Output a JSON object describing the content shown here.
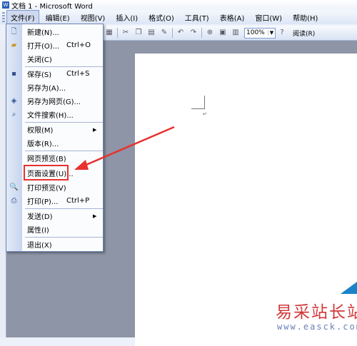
{
  "window": {
    "app_icon_letter": "W",
    "title": "文档 1 - Microsoft Word"
  },
  "menubar": [
    {
      "label": "文件(F)",
      "active": true
    },
    {
      "label": "编辑(E)"
    },
    {
      "label": "视图(V)"
    },
    {
      "label": "插入(I)"
    },
    {
      "label": "格式(O)"
    },
    {
      "label": "工具(T)"
    },
    {
      "label": "表格(A)"
    },
    {
      "label": "窗口(W)"
    },
    {
      "label": "帮助(H)"
    }
  ],
  "toolbar": {
    "zoom_value": "100%",
    "read_label": "阅读(R)"
  },
  "file_menu": {
    "items": [
      {
        "label": "新建(N)...",
        "shortcut": "",
        "icon": "new-doc-icon"
      },
      {
        "label": "打开(O)...",
        "shortcut": "Ctrl+O",
        "icon": "open-folder-icon"
      },
      {
        "label": "关闭(C)",
        "shortcut": "",
        "icon": ""
      },
      {
        "label": "保存(S)",
        "shortcut": "Ctrl+S",
        "icon": "save-disk-icon"
      },
      {
        "label": "另存为(A)...",
        "shortcut": "",
        "icon": ""
      },
      {
        "label": "另存为网页(G)...",
        "shortcut": "",
        "icon": "save-web-icon"
      },
      {
        "label": "文件搜索(H)...",
        "shortcut": "",
        "icon": "file-search-icon"
      },
      {
        "label": "权限(M)",
        "shortcut": "",
        "icon": "",
        "submenu": true
      },
      {
        "label": "版本(R)...",
        "shortcut": "",
        "icon": ""
      },
      {
        "label": "网页预览(B)",
        "shortcut": "",
        "icon": ""
      },
      {
        "label": "页面设置(U)...",
        "shortcut": "",
        "icon": "",
        "highlighted": true
      },
      {
        "label": "打印预览(V)",
        "shortcut": "",
        "icon": "print-preview-icon"
      },
      {
        "label": "打印(P)...",
        "shortcut": "Ctrl+P",
        "icon": "printer-icon"
      },
      {
        "label": "发送(D)",
        "shortcut": "",
        "icon": "",
        "submenu": true
      },
      {
        "label": "属性(I)",
        "shortcut": "",
        "icon": ""
      },
      {
        "label": "退出(X)",
        "shortcut": "",
        "icon": ""
      }
    ]
  },
  "document": {
    "paragraph_mark": "↵"
  },
  "watermark": {
    "text_cn": "易采站长站",
    "url": "www.easck.com"
  },
  "colors": {
    "highlight_red": "#e8312f",
    "menu_border": "#6d84b4",
    "workspace_gray": "#8d95a6"
  }
}
